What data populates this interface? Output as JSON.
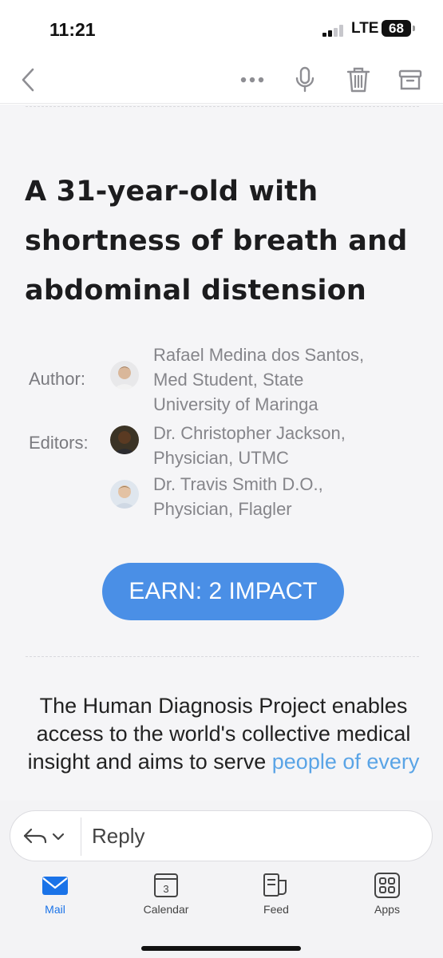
{
  "status_bar": {
    "time": "11:21",
    "network": "LTE",
    "battery": "68"
  },
  "toolbar": {
    "icons": [
      "chevron-left-icon",
      "more-icon",
      "microphone-icon",
      "trash-icon",
      "archive-icon"
    ]
  },
  "email": {
    "title": "A 31-year-old with shortness of breath and abdominal distension",
    "author_label": "Author:",
    "editors_label": "Editors:",
    "author": {
      "line1": "Rafael Medina dos Santos,",
      "line2": "Med Student, State",
      "line3": "University of Maringa"
    },
    "editors": [
      {
        "line1": "Dr. Christopher Jackson,",
        "line2": "Physician, UTMC"
      },
      {
        "line1": "Dr. Travis Smith D.O.,",
        "line2": "Physician, Flagler"
      }
    ],
    "earn_button": "EARN: 2 IMPACT",
    "intro_text": "The Human Diagnosis Project enables access to the world's collective medical insight and aims to serve ",
    "intro_link": "people of every"
  },
  "reply": {
    "placeholder": "Reply"
  },
  "tabs": [
    {
      "label": "Mail",
      "icon": "mail-icon",
      "active": true
    },
    {
      "label": "Calendar",
      "icon": "calendar-icon",
      "badge": "3"
    },
    {
      "label": "Feed",
      "icon": "feed-icon"
    },
    {
      "label": "Apps",
      "icon": "apps-icon"
    }
  ],
  "colors": {
    "accent": "#1a73e8",
    "earn_button": "#4a8fe6",
    "link": "#5aa4e6",
    "content_bg": "#f5f5f7"
  }
}
